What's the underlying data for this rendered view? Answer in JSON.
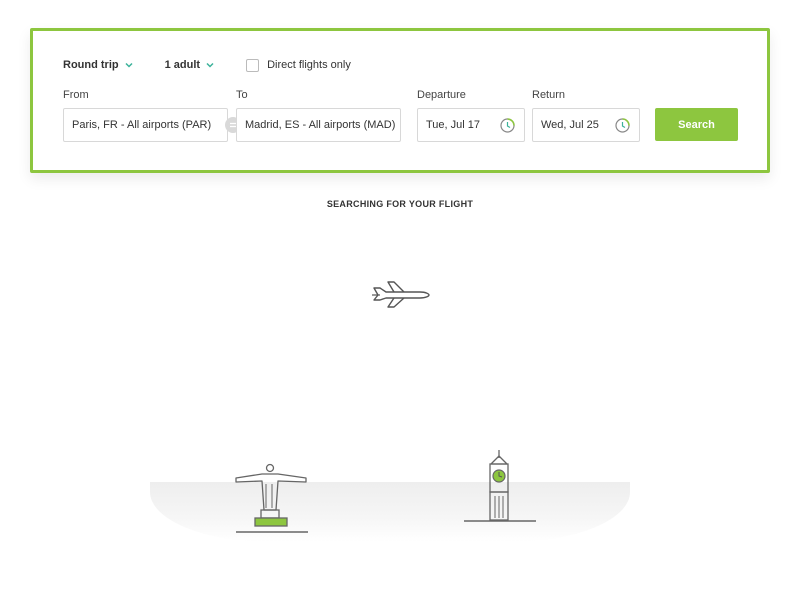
{
  "options": {
    "trip_type": "Round trip",
    "passengers": "1 adult",
    "direct_label": "Direct flights only"
  },
  "labels": {
    "from": "From",
    "to": "To",
    "departure": "Departure",
    "return": "Return"
  },
  "fields": {
    "from_value": "Paris, FR - All airports (PAR)",
    "to_value": "Madrid, ES - All airports (MAD)",
    "departure_value": "Tue, Jul 17",
    "return_value": "Wed, Jul 25"
  },
  "search_label": "Search",
  "status_text": "SEARCHING FOR YOUR FLIGHT",
  "colors": {
    "accent": "#8dc63f",
    "icon_teal": "#3bb29a",
    "line": "#666666"
  },
  "icons": {
    "trip_chevron": "chevron-down-icon",
    "pax_chevron": "chevron-down-icon",
    "swap": "swap-icon",
    "departure_calendar": "calendar-clock-icon",
    "return_calendar": "calendar-clock-icon",
    "plane": "airplane-icon",
    "landmark_left": "christ-redeemer-icon",
    "landmark_right": "big-ben-icon"
  }
}
